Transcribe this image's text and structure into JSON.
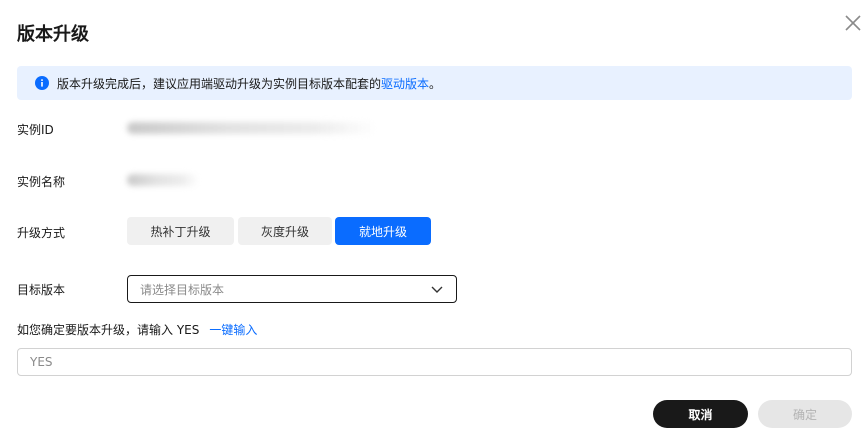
{
  "dialog": {
    "title": "版本升级"
  },
  "alert": {
    "text": "版本升级完成后，建议应用端驱动升级为实例目标版本配套的",
    "link": "驱动版本",
    "suffix": "。"
  },
  "fields": {
    "instance_id_label": "实例ID",
    "instance_name_label": "实例名称",
    "upgrade_mode_label": "升级方式",
    "target_version_label": "目标版本"
  },
  "upgrade_modes": {
    "options": [
      "热补丁升级",
      "灰度升级",
      "就地升级"
    ],
    "selected": "就地升级"
  },
  "target_version": {
    "placeholder": "请选择目标版本"
  },
  "confirm": {
    "hint": "如您确定要版本升级，请输入 YES",
    "link": "一键输入",
    "placeholder": "YES"
  },
  "footer": {
    "cancel_label": "取消",
    "ok_label": "确定"
  },
  "colors": {
    "primary": "#0a6cff",
    "alert_bg": "#e8f1ff",
    "cancel_bg": "#191919",
    "disabled_bg": "#e6e6e6"
  }
}
